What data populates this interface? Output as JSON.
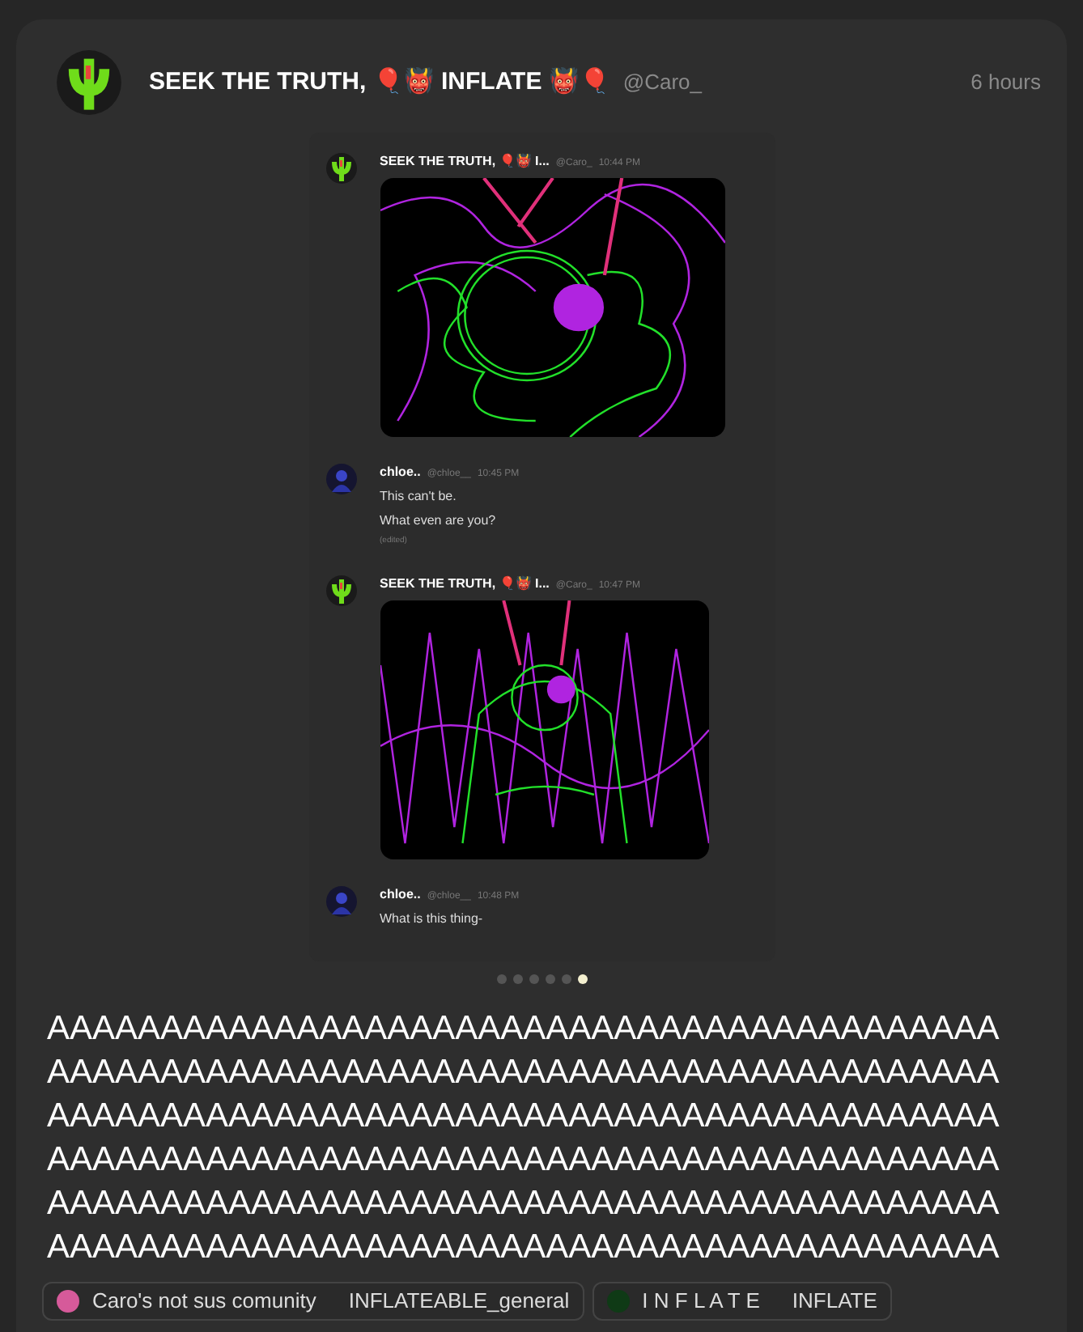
{
  "post": {
    "author": "SEEK THE TRUTH, 🎈👹 INFLATE 👹🎈",
    "handle": "@Caro_",
    "time": "6 hours"
  },
  "screenshot": {
    "messages": [
      {
        "kind": "image",
        "author": "SEEK THE TRUTH, 🎈👹 I...",
        "handle": "@Caro_",
        "time": "10:44 PM"
      },
      {
        "kind": "text",
        "author": "chloe..",
        "handle": "@chloe__",
        "time": "10:45 PM",
        "lines": [
          "This can't be.",
          "What even are you?"
        ],
        "edited": "(edited)"
      },
      {
        "kind": "image",
        "author": "SEEK THE TRUTH, 🎈👹 I...",
        "handle": "@Caro_",
        "time": "10:47 PM"
      },
      {
        "kind": "text",
        "author": "chloe..",
        "handle": "@chloe__",
        "time": "10:48 PM",
        "lines": [
          "What is this thing-"
        ]
      }
    ]
  },
  "carousel": [
    {
      "selected": false
    },
    {
      "selected": false
    },
    {
      "selected": false
    },
    {
      "selected": false
    },
    {
      "selected": false
    },
    {
      "selected": true
    }
  ],
  "body": "AAAAAAAAAAAAAAAAAAAAAAAAAAAAAAAAAAAAAAAAAAAAAAAAAAAAAAAAAAAAAAAAAAAAAAAAAAAAAAAAAAAAAAAAAAAAAAAAAAAAAAAAAAAAAAAAAAAAAAAAAAAAAAAAAAAAAAAAAAAAAAAAAAAAAAAAAAAAAAAAAAAAAAAAAAAAAAAAAAAAAAAAAAAAAAAAAAAAAAAAAAAAAAAAAAAAAAAAAAAAAAAAAAAAAAAAAAAAAAAAAAAAAAAAAAAA",
  "tags": [
    {
      "community": "Caro's not sus comunity",
      "channel": "INFLATEABLE_general"
    },
    {
      "community": "I N F L A T E",
      "channel": "INFLATE"
    }
  ]
}
